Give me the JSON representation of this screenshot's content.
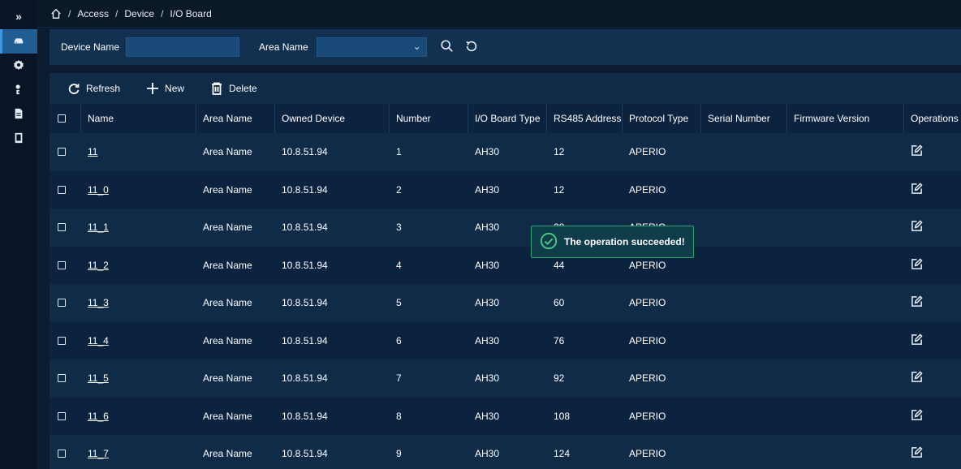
{
  "sidebar": {
    "expand_glyph": "»",
    "items": [
      {
        "icon": "device-icon",
        "active": true
      },
      {
        "icon": "gear-icon"
      },
      {
        "icon": "person-setting-icon"
      },
      {
        "icon": "document-icon"
      },
      {
        "icon": "tablet-icon"
      }
    ]
  },
  "breadcrumb": {
    "items": [
      "Access",
      "Device",
      "I/O Board"
    ],
    "sep": "/"
  },
  "filter": {
    "device_name_label": "Device Name",
    "device_name_value": "",
    "area_name_label": "Area Name",
    "area_name_value": "",
    "chevron": "⌄"
  },
  "toolbar": {
    "refresh_label": "Refresh",
    "new_label": "New",
    "delete_label": "Delete"
  },
  "table": {
    "headers": [
      "Name",
      "Area Name",
      "Owned Device",
      "Number",
      "I/O Board Type",
      "RS485 Address",
      "Protocol Type",
      "Serial Number",
      "Firmware Version",
      "Operations"
    ],
    "rows": [
      {
        "name": "11",
        "area": "Area Name",
        "device": "10.8.51.94",
        "number": "1",
        "type": "AH30",
        "rs485": "12",
        "protocol": "APERIO",
        "serial": "",
        "firmware": ""
      },
      {
        "name": "11_0",
        "area": "Area Name",
        "device": "10.8.51.94",
        "number": "2",
        "type": "AH30",
        "rs485": "12",
        "protocol": "APERIO",
        "serial": "",
        "firmware": ""
      },
      {
        "name": "11_1",
        "area": "Area Name",
        "device": "10.8.51.94",
        "number": "3",
        "type": "AH30",
        "rs485": "28",
        "protocol": "APERIO",
        "serial": "",
        "firmware": ""
      },
      {
        "name": "11_2",
        "area": "Area Name",
        "device": "10.8.51.94",
        "number": "4",
        "type": "AH30",
        "rs485": "44",
        "protocol": "APERIO",
        "serial": "",
        "firmware": ""
      },
      {
        "name": "11_3",
        "area": "Area Name",
        "device": "10.8.51.94",
        "number": "5",
        "type": "AH30",
        "rs485": "60",
        "protocol": "APERIO",
        "serial": "",
        "firmware": ""
      },
      {
        "name": "11_4",
        "area": "Area Name",
        "device": "10.8.51.94",
        "number": "6",
        "type": "AH30",
        "rs485": "76",
        "protocol": "APERIO",
        "serial": "",
        "firmware": ""
      },
      {
        "name": "11_5",
        "area": "Area Name",
        "device": "10.8.51.94",
        "number": "7",
        "type": "AH30",
        "rs485": "92",
        "protocol": "APERIO",
        "serial": "",
        "firmware": ""
      },
      {
        "name": "11_6",
        "area": "Area Name",
        "device": "10.8.51.94",
        "number": "8",
        "type": "AH30",
        "rs485": "108",
        "protocol": "APERIO",
        "serial": "",
        "firmware": ""
      },
      {
        "name": "11_7",
        "area": "Area Name",
        "device": "10.8.51.94",
        "number": "9",
        "type": "AH30",
        "rs485": "124",
        "protocol": "APERIO",
        "serial": "",
        "firmware": ""
      }
    ]
  },
  "toast": {
    "message": "The operation succeeded!"
  },
  "colors": {
    "accent": "#1f5d92",
    "success": "#49d086"
  }
}
